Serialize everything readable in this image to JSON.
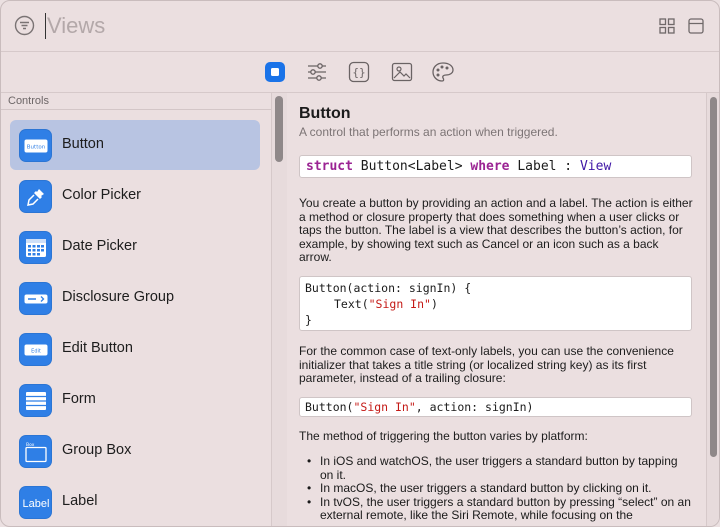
{
  "search": {
    "value": "Views"
  },
  "toolbar": {
    "tools": [
      "views-tab",
      "modifiers-tab",
      "code-snippets-tab",
      "images-tab",
      "colors-tab"
    ]
  },
  "sidebar": {
    "header": "Controls",
    "items": [
      {
        "label": "Button",
        "icon": "button-icon",
        "icon_text": "Button",
        "selected": true
      },
      {
        "label": "Color Picker",
        "icon": "eyedropper-icon"
      },
      {
        "label": "Date Picker",
        "icon": "calendar-icon"
      },
      {
        "label": "Disclosure Group",
        "icon": "disclosure-icon"
      },
      {
        "label": "Edit Button",
        "icon": "edit-button-icon",
        "icon_text": "Edit"
      },
      {
        "label": "Form",
        "icon": "form-icon"
      },
      {
        "label": "Group Box",
        "icon": "group-box-icon",
        "icon_text": "Box"
      },
      {
        "label": "Label",
        "icon": "label-icon",
        "icon_text": "Label"
      }
    ]
  },
  "detail": {
    "title": "Button",
    "subtitle": "A control that performs an action when triggered.",
    "declaration": {
      "kw1": "struct",
      "name": " Button<Label> ",
      "kw2": "where",
      "constraint": " Label : ",
      "protocol": "View"
    },
    "para1": "You create a button by providing an action and a label. The action is either a method or closure property that does something when a user clicks or taps the button. The label is a view that describes the button’s action, for example, by showing text such as Cancel or an icon such as a back arrow.",
    "code1": {
      "line1": "Button(action: signIn) {",
      "line2_pre": "Text(",
      "line2_str": "\"Sign In\"",
      "line2_post": ")",
      "line3": "}"
    },
    "para2": "For the common case of text-only labels, you can use the convenience initializer that takes a title string (or localized string key) as its first parameter, instead of a trailing closure:",
    "code2": {
      "pre": "Button(",
      "str": "\"Sign In\"",
      "post": ", action: signIn)"
    },
    "para3": "The method of triggering the button varies by platform:",
    "bullets": [
      "In iOS and watchOS, the user triggers a standard button by tapping on it.",
      "In macOS, the user triggers a standard button by clicking on it.",
      "In tvOS, the user triggers a standard button by pressing “select” on an external remote, like the Siri Remote, while focusing on the"
    ]
  },
  "colors": {
    "accent": "#1a73e8",
    "icon_blue": "#2f7fe6",
    "selection": "#b8c4e2",
    "keyword": "#9b2393",
    "string": "#c41a16"
  }
}
